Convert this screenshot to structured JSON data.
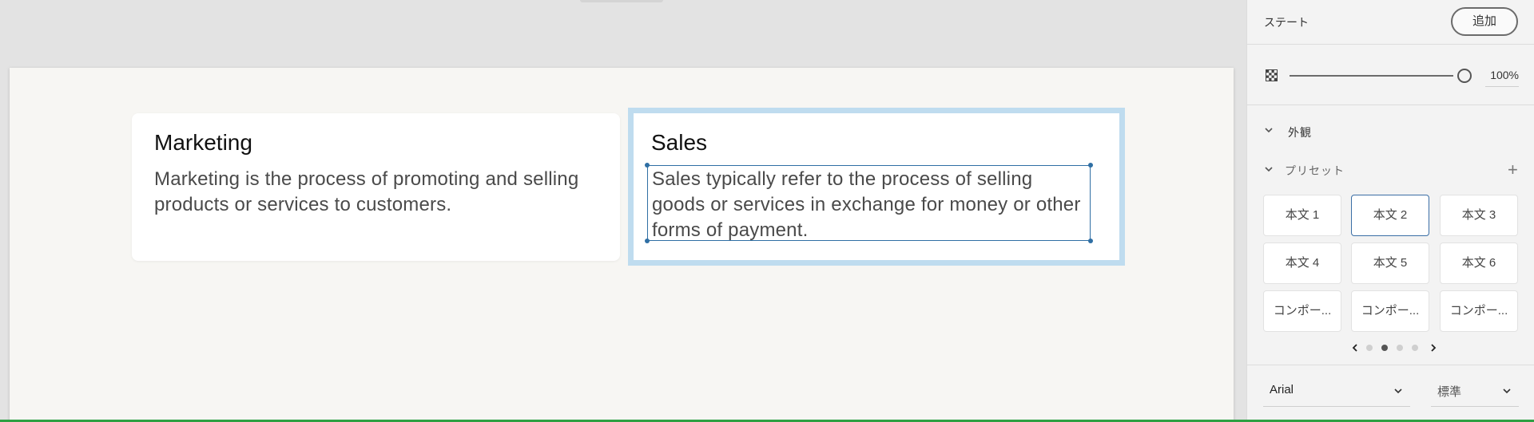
{
  "canvas": {
    "cards": [
      {
        "title": "Marketing",
        "body": "Marketing is the process of promoting and selling products or services to customers."
      },
      {
        "title": "Sales",
        "body": "Sales typically refer to the process of selling goods or services in exchange for money or other forms of payment."
      }
    ]
  },
  "panel": {
    "state_label": "ステート",
    "add_label": "追加",
    "opacity": {
      "value": "100%",
      "level": 1.0
    },
    "appearance_label": "外観",
    "presets_label": "プリセット",
    "presets": [
      "本文 1",
      "本文 2",
      "本文 3",
      "本文 4",
      "本文 5",
      "本文 6",
      "コンポー...",
      "コンポー...",
      "コンポー..."
    ],
    "active_preset": "本文 2",
    "pagination": {
      "pages": 4,
      "current": 2
    },
    "font_family": "Arial",
    "font_weight": "標準"
  },
  "colors": {
    "selection": "#2f6fa4",
    "selection_halo": "#bfdcef",
    "artboard": "#f7f6f3",
    "panel": "#f3f3f3"
  },
  "icons": [
    "opacity-checker-icon",
    "chevron-down-icon",
    "plus-icon",
    "chevron-left-icon",
    "chevron-right-icon"
  ]
}
